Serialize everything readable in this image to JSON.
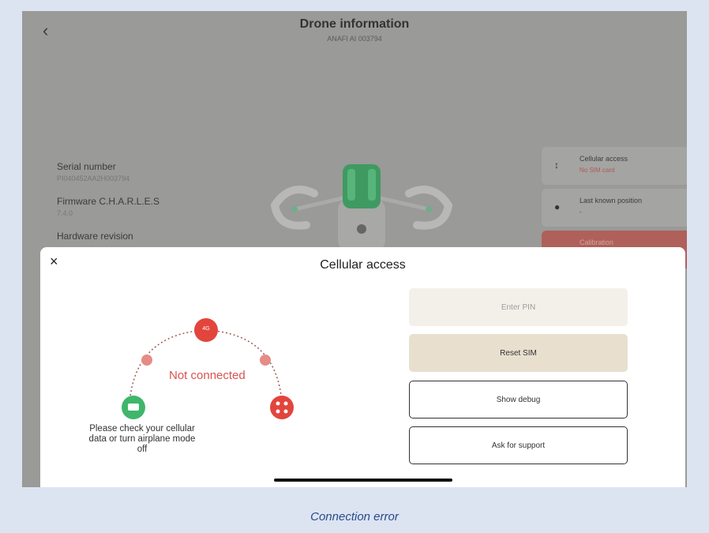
{
  "header": {
    "title": "Drone information",
    "subtitle": "ANAFI AI 003794"
  },
  "info": [
    {
      "label": "Serial number",
      "value": "PI040452AA2H003794"
    },
    {
      "label": "Firmware C.H.A.R.L.E.S",
      "value": "7.4.0"
    },
    {
      "label": "Hardware revision",
      "value": ""
    }
  ],
  "cards": [
    {
      "title": "Cellular access",
      "subtitle": "No SIM card",
      "icon": "signal-arrows-icon"
    },
    {
      "title": "Last known position",
      "subtitle": "-",
      "icon": "location-pin-icon"
    },
    {
      "title": "Calibration",
      "subtitle": "",
      "icon": "calibration-icon"
    }
  ],
  "modal": {
    "title": "Cellular access",
    "close": "×",
    "status": "Not connected",
    "node_4g": "4G",
    "message": "Please check your cellular data or turn airplane mode off",
    "buttons": {
      "pin": "Enter PIN",
      "reset": "Reset SIM",
      "debug": "Show debug",
      "support": "Ask for support"
    }
  },
  "caption": "Connection error",
  "colors": {
    "error": "#e2453c",
    "ok": "#3fb66b",
    "accent_bg": "#e8dfcf"
  }
}
